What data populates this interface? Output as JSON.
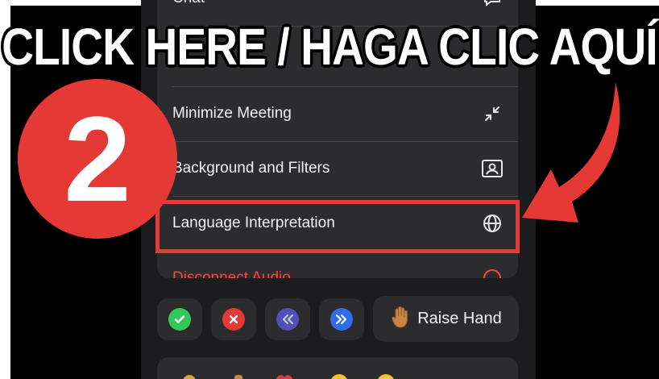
{
  "banner": {
    "text": "CLICK HERE / HAGA CLIC AQUÍ"
  },
  "step": {
    "number": "2"
  },
  "menu": {
    "items": [
      {
        "label": "Chat",
        "icon": "chat-bubble-icon"
      },
      {
        "label": "…",
        "icon": ""
      },
      {
        "label": "Minimize Meeting",
        "icon": "minimize-arrows-icon"
      },
      {
        "label": "Background and Filters",
        "icon": "portrait-frame-icon"
      },
      {
        "label": "Language Interpretation",
        "icon": "globe-icon"
      },
      {
        "label": "Disconnect Audio",
        "icon": "disconnect-audio-icon"
      }
    ]
  },
  "reactions": {
    "yes": {
      "icon": "check-icon",
      "color": "#34c759"
    },
    "no": {
      "icon": "x-icon",
      "color": "#e53935"
    },
    "slower": {
      "icon": "rewind-icon",
      "color": "#5e5ce6"
    },
    "faster": {
      "icon": "fast-forward-icon",
      "color": "#2f6fed"
    },
    "raise_hand": {
      "label": "Raise Hand",
      "icon": "raised-hand-icon"
    }
  },
  "colors": {
    "accent_red": "#e53935",
    "disconnect_red": "#ff453a"
  }
}
